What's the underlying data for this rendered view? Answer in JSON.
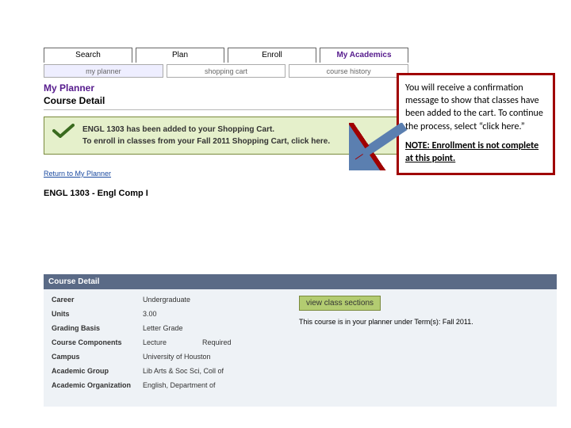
{
  "nav": {
    "tabs": [
      "Search",
      "Plan",
      "Enroll",
      "My Academics"
    ],
    "subtabs": [
      "my planner",
      "shopping cart",
      "course history"
    ]
  },
  "headings": {
    "planner": "My Planner",
    "detail": "Course Detail"
  },
  "confirm": {
    "line1": "ENGL 1303 has been added to your Shopping Cart.",
    "line2a": "To enroll in classes from your Fall 2011 Shopping Cart, ",
    "click_here": "click here."
  },
  "links": {
    "return": "Return to My Planner"
  },
  "course": {
    "title": "ENGL 1303 - Engl Comp I"
  },
  "detail": {
    "heading": "Course Detail",
    "career_lab": "Career",
    "career_val": "Undergraduate",
    "units_lab": "Units",
    "units_val": "3.00",
    "grading_lab": "Grading Basis",
    "grading_val": "Letter Grade",
    "components_lab": "Course Components",
    "components_val": "Lecture",
    "components_extra": "Required",
    "campus_lab": "Campus",
    "campus_val": "University of Houston",
    "group_lab": "Academic Group",
    "group_val": "Lib Arts & Soc Sci, Coll of",
    "org_lab": "Academic Organization",
    "org_val": "English, Department of",
    "view_btn": "view class sections",
    "planned_note": "This course is in your planner under Term(s): Fall 2011."
  },
  "callout": {
    "body": "You will receive  a confirmation message to show that classes have been added to the cart. To continue the process, select “click here.”",
    "note": "NOTE: Enrollment is not complete at this point."
  }
}
